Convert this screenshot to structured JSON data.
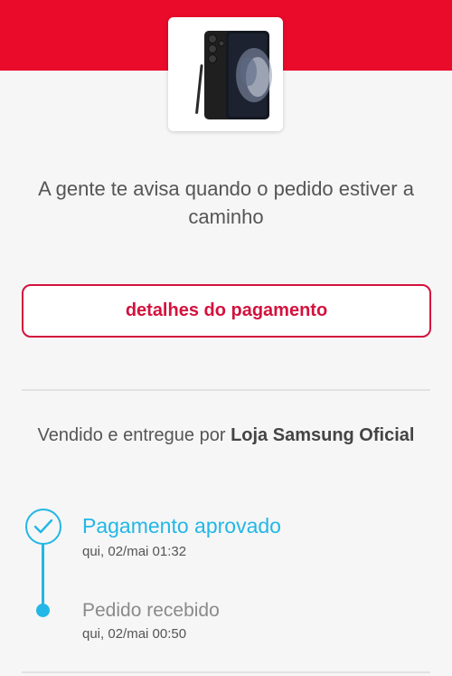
{
  "product": {
    "image_icon": "smartphone-with-stylus"
  },
  "headline": "A gente te avisa quando o pedido estiver a caminho",
  "payment_details_button": "detalhes do pagamento",
  "seller": {
    "prefix": "Vendido e entregue por",
    "name": "Loja Samsung Oficial"
  },
  "timeline": [
    {
      "title": "Pagamento aprovado",
      "date": "qui, 02/mai 01:32",
      "status": "done",
      "icon": "check-icon"
    },
    {
      "title": "Pedido recebido",
      "date": "qui, 02/mai 00:50",
      "status": "past",
      "icon": "dot-icon"
    }
  ],
  "colors": {
    "brand_red": "#ea0a2a",
    "button_red": "#d3123d",
    "timeline_blue": "#22b7e6",
    "background": "#f6f6f6"
  }
}
